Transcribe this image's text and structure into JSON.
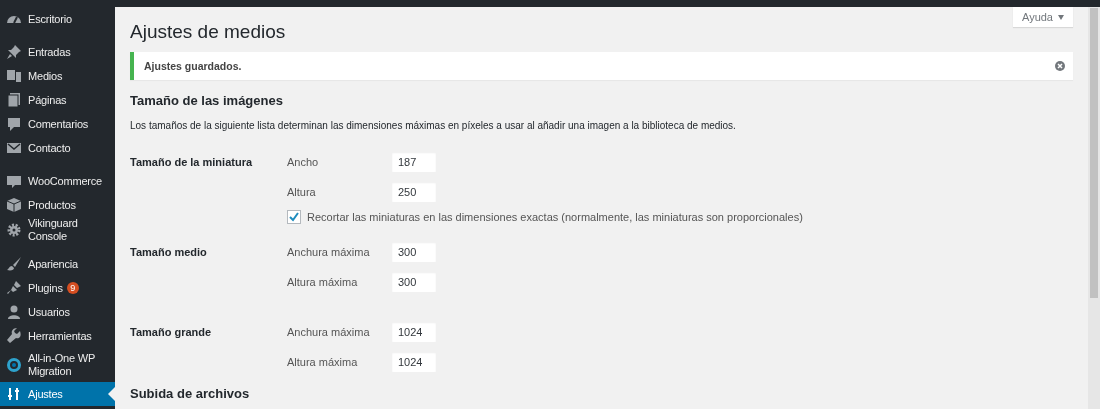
{
  "sidebar": {
    "groups": [
      {
        "items": [
          {
            "label": "Escritorio",
            "selected": false
          }
        ]
      },
      {
        "items": [
          {
            "label": "Entradas",
            "selected": false
          },
          {
            "label": "Medios",
            "selected": false
          },
          {
            "label": "Páginas",
            "selected": false
          },
          {
            "label": "Comentarios",
            "selected": false
          },
          {
            "label": "Contacto",
            "selected": false
          }
        ]
      },
      {
        "items": [
          {
            "label": "WooCommerce",
            "selected": false
          },
          {
            "label": "Productos",
            "selected": false
          },
          {
            "label": "Vikinguard Console",
            "selected": false
          }
        ]
      },
      {
        "items": [
          {
            "label": "Apariencia",
            "selected": false
          },
          {
            "label": "Plugins",
            "selected": false,
            "badge": "9"
          },
          {
            "label": "Usuarios",
            "selected": false
          },
          {
            "label": "Herramientas",
            "selected": false
          },
          {
            "label": "All-in-One WP Migration",
            "selected": false
          },
          {
            "label": "Ajustes",
            "selected": true
          }
        ]
      }
    ]
  },
  "help_button": "Ayuda",
  "title": "Ajustes de medios",
  "notice": {
    "text": "Ajustes guardados."
  },
  "section": {
    "heading": "Tamaño de las imágenes",
    "description": "Los tamaños de la siguiente lista determinan las dimensiones máximas en píxeles a usar al añadir una imagen a la biblioteca de medios.",
    "sizes": [
      {
        "label": "Tamaño de la miniatura",
        "fields": [
          {
            "label": "Ancho",
            "value": "187"
          },
          {
            "label": "Altura",
            "value": "250"
          }
        ],
        "option": {
          "label": "Recortar las miniaturas en las dimensiones exactas (normalmente, las miniaturas son proporcionales)",
          "checked": true
        }
      },
      {
        "label": "Tamaño medio",
        "fields": [
          {
            "label": "Anchura máxima",
            "value": "300"
          },
          {
            "label": "Altura máxima",
            "value": "300"
          }
        ]
      },
      {
        "label": "Tamaño grande",
        "fields": [
          {
            "label": "Anchura máxima",
            "value": "1024"
          },
          {
            "label": "Altura máxima",
            "value": "1024"
          }
        ]
      }
    ]
  },
  "next_section": {
    "heading": "Subida de archivos"
  }
}
